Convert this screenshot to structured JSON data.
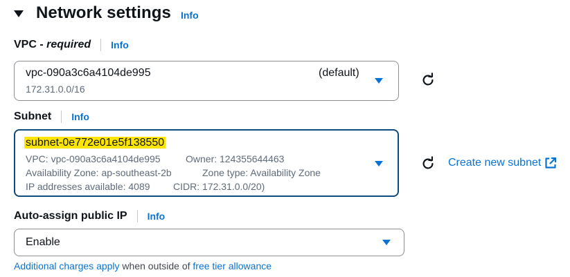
{
  "section": {
    "title": "Network settings",
    "info": "Info"
  },
  "vpc": {
    "label_main": "VPC - ",
    "label_required": "required",
    "info": "Info",
    "value": "vpc-090a3c6a4104de995",
    "tag": "(default)",
    "cidr": "172.31.0.0/16"
  },
  "subnet": {
    "label": "Subnet",
    "info": "Info",
    "value": "subnet-0e772e01e5f138550",
    "line1_a": "VPC: vpc-090a3c6a4104de995",
    "line1_b": "Owner: 124355644463",
    "line2_a": "Availability Zone: ap-southeast-2b",
    "line2_b": "Zone type: Availability Zone",
    "line3_a": "IP addresses available: 4089",
    "line3_b": "CIDR: 172.31.0.0/20)",
    "create_link": "Create new subnet"
  },
  "public_ip": {
    "label": "Auto-assign public IP",
    "info": "Info",
    "value": "Enable"
  },
  "footer": {
    "link1": "Additional charges apply",
    "middle": " when outside of ",
    "link2": "free tier allowance"
  },
  "colors": {
    "link": "#0972d3",
    "highlight": "#ffe500",
    "focus_border": "#0f4a7a"
  },
  "icons": [
    "caret-down-icon",
    "refresh-icon",
    "external-link-icon",
    "dropdown-arrow-icon"
  ]
}
